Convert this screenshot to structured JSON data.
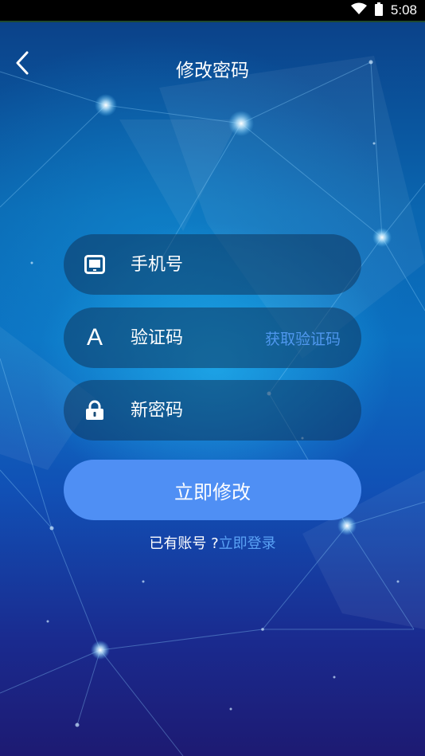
{
  "status_bar": {
    "time": "5:08",
    "icons": [
      "wifi-icon",
      "battery-icon"
    ]
  },
  "header": {
    "title": "修改密码",
    "back_icon": "chevron-left-icon"
  },
  "form": {
    "phone": {
      "placeholder": "手机号",
      "value": "",
      "icon": "phone-icon"
    },
    "code": {
      "placeholder": "验证码",
      "value": "",
      "icon": "letter-a-icon",
      "icon_text": "A",
      "get_code_label": "获取验证码"
    },
    "password": {
      "placeholder": "新密码",
      "value": "",
      "icon": "lock-icon"
    },
    "submit_label": "立即修改"
  },
  "footer": {
    "prompt": "已有账号 ?",
    "login_link": "立即登录"
  },
  "colors": {
    "accent": "#4f8ff4",
    "link": "#4f97ee",
    "field_bg": "rgba(15,55,95,0.55)"
  }
}
